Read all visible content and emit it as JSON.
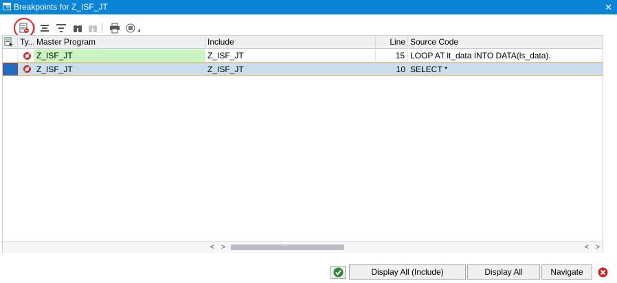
{
  "window": {
    "title": "Breakpoints for Z_ISF_JT",
    "close_glyph": "✕"
  },
  "toolbar": {
    "buttons": [
      {
        "icon": "delete-breakpoint-icon",
        "highlighted": true
      },
      {
        "icon": "align-center-icon"
      },
      {
        "icon": "filter-icon"
      },
      {
        "icon": "find-icon"
      },
      {
        "icon": "find-next-icon",
        "disabled": true
      },
      {
        "icon": "print-icon"
      },
      {
        "icon": "export-menu-icon"
      }
    ]
  },
  "grid": {
    "columns": {
      "type": "Ty...",
      "master_program": "Master Program",
      "include": "Include",
      "line": "Line",
      "source_code": "Source Code"
    },
    "rows": [
      {
        "master_program": "Z_ISF_JT",
        "include": "Z_ISF_JT",
        "line": "15",
        "source_code": "LOOP AT lt_data INTO DATA(ls_data)."
      },
      {
        "master_program": "Z_ISF_JT",
        "include": "Z_ISF_JT",
        "line": "10",
        "source_code": "SELECT *"
      }
    ],
    "scroll": {
      "left": "<",
      "right": ">",
      "thumb": "..."
    }
  },
  "footer": {
    "display_all_include": "Display All (Include)",
    "display_all": "Display All",
    "navigate": "Navigate"
  },
  "colors": {
    "titlebar": "#0a84d6",
    "row_highlight_green": "#c8f5c0",
    "row_selected_blue": "#c9dff0",
    "highlight_ring": "#e02020"
  }
}
